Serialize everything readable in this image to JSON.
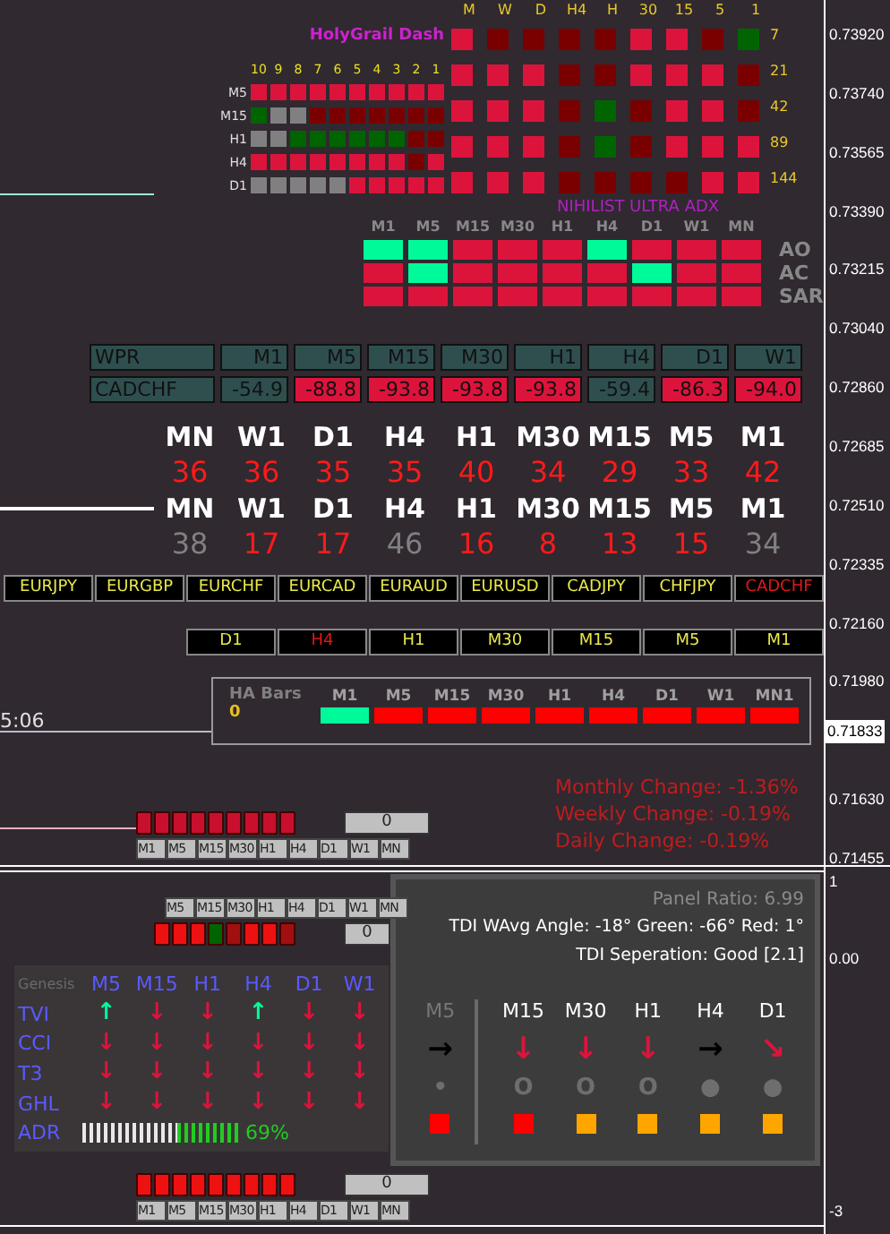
{
  "price_axis": {
    "labels": [
      "0.73920",
      "0.73740",
      "0.73565",
      "0.73390",
      "0.73215",
      "0.73040",
      "0.72860",
      "0.72685",
      "0.72510",
      "0.72335",
      "0.72160",
      "0.71980",
      "0.71630",
      "0.71455"
    ],
    "current_price": "0.71833"
  },
  "time_label": "5:06",
  "holygrail_dash": {
    "title": "HolyGrail Dash",
    "columns": [
      "M",
      "W",
      "D",
      "H4",
      "H",
      "30",
      "15",
      "5",
      "1"
    ],
    "rows": [
      {
        "period": "7",
        "cells": [
          {
            "color": "#dc143c"
          },
          {
            "color": "#7a0000"
          },
          {
            "color": "#7a0000"
          },
          {
            "color": "#7a0000"
          },
          {
            "color": "#7a0000"
          },
          {
            "color": "#dc143c"
          },
          {
            "color": "#dc143c"
          },
          {
            "color": "#7a0000"
          },
          {
            "color": "#006400"
          }
        ]
      },
      {
        "period": "21",
        "cells": [
          {
            "color": "#dc143c"
          },
          {
            "color": "#dc143c"
          },
          {
            "color": "#dc143c"
          },
          {
            "color": "#7a0000"
          },
          {
            "color": "#7a0000"
          },
          {
            "color": "#dc143c"
          },
          {
            "color": "#dc143c"
          },
          {
            "color": "#dc143c"
          },
          {
            "color": "#7a0000"
          }
        ]
      },
      {
        "period": "42",
        "cells": [
          {
            "color": "#dc143c"
          },
          {
            "color": "#dc143c"
          },
          {
            "color": "#dc143c"
          },
          {
            "color": "#7a0000"
          },
          {
            "color": "#006400"
          },
          {
            "color": "#7a0000"
          },
          {
            "color": "#dc143c"
          },
          {
            "color": "#dc143c"
          },
          {
            "color": "#7a0000"
          }
        ]
      },
      {
        "period": "89",
        "cells": [
          {
            "color": "#dc143c"
          },
          {
            "color": "#dc143c"
          },
          {
            "color": "#dc143c"
          },
          {
            "color": "#7a0000"
          },
          {
            "color": "#006400"
          },
          {
            "color": "#7a0000"
          },
          {
            "color": "#dc143c"
          },
          {
            "color": "#dc143c"
          },
          {
            "color": "#dc143c"
          }
        ]
      },
      {
        "period": "144",
        "cells": [
          {
            "color": "#dc143c"
          },
          {
            "color": "#dc143c"
          },
          {
            "color": "#dc143c"
          },
          {
            "color": "#7a0000"
          },
          {
            "color": "#7a0000"
          },
          {
            "color": "#7a0000"
          },
          {
            "color": "#7a0000"
          },
          {
            "color": "#dc143c"
          },
          {
            "color": "#dc143c"
          }
        ]
      }
    ],
    "bar_numbers": [
      "10",
      "9",
      "8",
      "7",
      "6",
      "5",
      "4",
      "3",
      "2",
      "1"
    ],
    "bar_rows": [
      {
        "label": "M5",
        "cells": [
          {
            "color": "#dc143c"
          },
          {
            "color": "#dc143c"
          },
          {
            "color": "#dc143c"
          },
          {
            "color": "#dc143c"
          },
          {
            "color": "#dc143c"
          },
          {
            "color": "#dc143c"
          },
          {
            "color": "#dc143c"
          },
          {
            "color": "#dc143c"
          },
          {
            "color": "#dc143c"
          },
          {
            "color": "#dc143c"
          }
        ]
      },
      {
        "label": "M15",
        "cells": [
          {
            "color": "#006400"
          },
          {
            "color": "#808080"
          },
          {
            "color": "#808080"
          },
          {
            "color": "#7a0000"
          },
          {
            "color": "#7a0000"
          },
          {
            "color": "#7a0000"
          },
          {
            "color": "#7a0000"
          },
          {
            "color": "#7a0000"
          },
          {
            "color": "#7a0000"
          },
          {
            "color": "#7a0000"
          }
        ]
      },
      {
        "label": "H1",
        "cells": [
          {
            "color": "#808080"
          },
          {
            "color": "#808080"
          },
          {
            "color": "#006400"
          },
          {
            "color": "#006400"
          },
          {
            "color": "#006400"
          },
          {
            "color": "#006400"
          },
          {
            "color": "#006400"
          },
          {
            "color": "#006400"
          },
          {
            "color": "#7a0000"
          },
          {
            "color": "#7a0000"
          }
        ]
      },
      {
        "label": "H4",
        "cells": [
          {
            "color": "#dc143c"
          },
          {
            "color": "#dc143c"
          },
          {
            "color": "#dc143c"
          },
          {
            "color": "#dc143c"
          },
          {
            "color": "#dc143c"
          },
          {
            "color": "#dc143c"
          },
          {
            "color": "#dc143c"
          },
          {
            "color": "#dc143c"
          },
          {
            "color": "#7a0000"
          },
          {
            "color": "#dc143c"
          }
        ]
      },
      {
        "label": "D1",
        "cells": [
          {
            "color": "#808080"
          },
          {
            "color": "#808080"
          },
          {
            "color": "#808080"
          },
          {
            "color": "#808080"
          },
          {
            "color": "#808080"
          },
          {
            "color": "#dc143c"
          },
          {
            "color": "#dc143c"
          },
          {
            "color": "#dc143c"
          },
          {
            "color": "#dc143c"
          },
          {
            "color": "#dc143c"
          }
        ]
      }
    ]
  },
  "ultra_adx": {
    "title": "NIHILIST ULTRA ADX",
    "columns": [
      "M1",
      "M5",
      "M15",
      "M30",
      "H1",
      "H4",
      "D1",
      "W1",
      "MN"
    ],
    "rows": [
      {
        "label": "AO",
        "cells": [
          {
            "color": "#00fa9a"
          },
          {
            "color": "#00fa9a"
          },
          {
            "color": "#dc143c"
          },
          {
            "color": "#dc143c"
          },
          {
            "color": "#dc143c"
          },
          {
            "color": "#00fa9a"
          },
          {
            "color": "#dc143c"
          },
          {
            "color": "#dc143c"
          },
          {
            "color": "#dc143c"
          }
        ]
      },
      {
        "label": "AC",
        "cells": [
          {
            "color": "#dc143c"
          },
          {
            "color": "#00fa9a"
          },
          {
            "color": "#dc143c"
          },
          {
            "color": "#dc143c"
          },
          {
            "color": "#dc143c"
          },
          {
            "color": "#dc143c"
          },
          {
            "color": "#00fa9a"
          },
          {
            "color": "#dc143c"
          },
          {
            "color": "#dc143c"
          }
        ]
      },
      {
        "label": "SAR",
        "cells": [
          {
            "color": "#dc143c"
          },
          {
            "color": "#dc143c"
          },
          {
            "color": "#dc143c"
          },
          {
            "color": "#dc143c"
          },
          {
            "color": "#dc143c"
          },
          {
            "color": "#dc143c"
          },
          {
            "color": "#dc143c"
          },
          {
            "color": "#dc143c"
          },
          {
            "color": "#dc143c"
          }
        ]
      }
    ]
  },
  "wpr_table": {
    "header": [
      "WPR",
      "M1",
      "M5",
      "M15",
      "M30",
      "H1",
      "H4",
      "D1",
      "W1"
    ],
    "symbol": "CADCHF",
    "values": [
      {
        "text": "-54.9",
        "color": "#2f4f4f"
      },
      {
        "text": "-88.8",
        "color": "#dc143c"
      },
      {
        "text": "-93.8",
        "color": "#dc143c"
      },
      {
        "text": "-93.8",
        "color": "#dc143c"
      },
      {
        "text": "-93.8",
        "color": "#dc143c"
      },
      {
        "text": "-59.4",
        "color": "#2f4f4f"
      },
      {
        "text": "-86.3",
        "color": "#dc143c"
      },
      {
        "text": "-94.0",
        "color": "#dc143c"
      }
    ]
  },
  "strength": [
    {
      "labels": [
        "MN",
        "W1",
        "D1",
        "H4",
        "H1",
        "M30",
        "M15",
        "M5",
        "M1"
      ],
      "values": [
        {
          "text": "36",
          "color": "#ff1a1a"
        },
        {
          "text": "36",
          "color": "#ff1a1a"
        },
        {
          "text": "35",
          "color": "#ff1a1a"
        },
        {
          "text": "35",
          "color": "#ff1a1a"
        },
        {
          "text": "40",
          "color": "#ff1a1a"
        },
        {
          "text": "34",
          "color": "#ff1a1a"
        },
        {
          "text": "29",
          "color": "#ff1a1a"
        },
        {
          "text": "33",
          "color": "#ff1a1a"
        },
        {
          "text": "42",
          "color": "#ff1a1a"
        }
      ]
    },
    {
      "labels": [
        "MN",
        "W1",
        "D1",
        "H4",
        "H1",
        "M30",
        "M15",
        "M5",
        "M1"
      ],
      "values": [
        {
          "text": "38",
          "color": "#808080"
        },
        {
          "text": "17",
          "color": "#ff1a1a"
        },
        {
          "text": "17",
          "color": "#ff1a1a"
        },
        {
          "text": "46",
          "color": "#808080"
        },
        {
          "text": "16",
          "color": "#ff1a1a"
        },
        {
          "text": "8",
          "color": "#ff1a1a"
        },
        {
          "text": "13",
          "color": "#ff1a1a"
        },
        {
          "text": "15",
          "color": "#ff1a1a"
        },
        {
          "text": "34",
          "color": "#808080"
        }
      ]
    }
  ],
  "pairs": [
    {
      "label": "EURJPY",
      "selected": false
    },
    {
      "label": "EURGBP",
      "selected": false
    },
    {
      "label": "EURCHF",
      "selected": false
    },
    {
      "label": "EURCAD",
      "selected": false
    },
    {
      "label": "EURAUD",
      "selected": false
    },
    {
      "label": "EURUSD",
      "selected": false
    },
    {
      "label": "CADJPY",
      "selected": false
    },
    {
      "label": "CHFJPY",
      "selected": false
    },
    {
      "label": "CADCHF",
      "selected": true
    }
  ],
  "timeframes": [
    {
      "label": "D1",
      "selected": false
    },
    {
      "label": "H4",
      "selected": true
    },
    {
      "label": "H1",
      "selected": false
    },
    {
      "label": "M30",
      "selected": false
    },
    {
      "label": "M15",
      "selected": false
    },
    {
      "label": "M5",
      "selected": false
    },
    {
      "label": "M1",
      "selected": false
    }
  ],
  "ha_bars": {
    "title": "HA Bars",
    "count": "0",
    "columns": [
      {
        "label": "M1",
        "color": "#00fa9a"
      },
      {
        "label": "M5",
        "color": "#ff0000"
      },
      {
        "label": "M15",
        "color": "#ff0000"
      },
      {
        "label": "M30",
        "color": "#ff0000"
      },
      {
        "label": "H1",
        "color": "#ff0000"
      },
      {
        "label": "H4",
        "color": "#ff0000"
      },
      {
        "label": "D1",
        "color": "#ff0000"
      },
      {
        "label": "W1",
        "color": "#ff0000"
      },
      {
        "label": "MN1",
        "color": "#ff0000"
      }
    ]
  },
  "changes": [
    "Monthly Change: -1.36%",
    "Weekly Change: -0.19%",
    "Daily Change: -0.19%"
  ],
  "mini_widgets": [
    {
      "kind": "labels_below",
      "cells": [
        {
          "color": "#c8102e"
        },
        {
          "color": "#c8102e"
        },
        {
          "color": "#c8102e"
        },
        {
          "color": "#c8102e"
        },
        {
          "color": "#c8102e"
        },
        {
          "color": "#c8102e"
        },
        {
          "color": "#c8102e"
        },
        {
          "color": "#c8102e"
        },
        {
          "color": "#c8102e"
        }
      ],
      "count": "0",
      "labels": [
        "M1",
        "M5",
        "M15",
        "M30",
        "H1",
        "H4",
        "D1",
        "W1",
        "MN"
      ]
    },
    {
      "kind": "labels_above",
      "cells": [
        {
          "color": "#ee1111"
        },
        {
          "color": "#ee1111"
        },
        {
          "color": "#ee1111"
        },
        {
          "color": "#006400"
        },
        {
          "color": "#a01010"
        },
        {
          "color": "#ee1111"
        },
        {
          "color": "#ee1111"
        },
        {
          "color": "#a01010"
        }
      ],
      "count": "0",
      "labels": [
        "M5",
        "M15",
        "M30",
        "H1",
        "H4",
        "D1",
        "W1",
        "MN"
      ]
    },
    {
      "kind": "labels_below",
      "cells": [
        {
          "color": "#ee1111"
        },
        {
          "color": "#ee1111"
        },
        {
          "color": "#ee1111"
        },
        {
          "color": "#ee1111"
        },
        {
          "color": "#ee1111"
        },
        {
          "color": "#ee1111"
        },
        {
          "color": "#ee1111"
        },
        {
          "color": "#ee1111"
        },
        {
          "color": "#ee1111"
        }
      ],
      "count": "0",
      "labels": [
        "M1",
        "M5",
        "M15",
        "M30",
        "H1",
        "H4",
        "D1",
        "W1",
        "MN"
      ]
    }
  ],
  "genesis": {
    "title": "Genesis",
    "columns": [
      "M5",
      "M15",
      "H1",
      "H4",
      "D1",
      "W1"
    ],
    "rows": [
      {
        "kind": "arrows",
        "label": "TVI",
        "arrows": [
          {
            "glyph": "↑",
            "color": "#00fa9a"
          },
          {
            "glyph": "↓",
            "color": "#dc143c"
          },
          {
            "glyph": "↓",
            "color": "#dc143c"
          },
          {
            "glyph": "↑",
            "color": "#00fa9a"
          },
          {
            "glyph": "↓",
            "color": "#dc143c"
          },
          {
            "glyph": "↓",
            "color": "#dc143c"
          }
        ]
      },
      {
        "kind": "arrows",
        "label": "CCI",
        "arrows": [
          {
            "glyph": "↓",
            "color": "#dc143c"
          },
          {
            "glyph": "↓",
            "color": "#dc143c"
          },
          {
            "glyph": "↓",
            "color": "#dc143c"
          },
          {
            "glyph": "↓",
            "color": "#dc143c"
          },
          {
            "glyph": "↓",
            "color": "#dc143c"
          },
          {
            "glyph": "↓",
            "color": "#dc143c"
          }
        ]
      },
      {
        "kind": "arrows",
        "label": "T3",
        "arrows": [
          {
            "glyph": "↓",
            "color": "#dc143c"
          },
          {
            "glyph": "↓",
            "color": "#dc143c"
          },
          {
            "glyph": "↓",
            "color": "#dc143c"
          },
          {
            "glyph": "↓",
            "color": "#dc143c"
          },
          {
            "glyph": "↓",
            "color": "#dc143c"
          },
          {
            "glyph": "↓",
            "color": "#dc143c"
          }
        ]
      },
      {
        "kind": "arrows",
        "label": "GHL",
        "arrows": [
          {
            "glyph": "↓",
            "color": "#dc143c"
          },
          {
            "glyph": "↓",
            "color": "#dc143c"
          },
          {
            "glyph": "↓",
            "color": "#dc143c"
          },
          {
            "glyph": "↓",
            "color": "#dc143c"
          },
          {
            "glyph": "↓",
            "color": "#dc143c"
          },
          {
            "glyph": "↓",
            "color": "#dc143c"
          }
        ]
      },
      {
        "kind": "meter",
        "label": "ADR",
        "level": 0.4,
        "reading": "69%"
      }
    ]
  },
  "tdi_panel": {
    "panel_ratio": "Panel Ratio: 6.99",
    "angle": "TDI WAvg Angle: -18°  Green: -66°  Red: 1°",
    "separation": "TDI Seperation: Good [2.1]",
    "columns": [
      {
        "label": "M5",
        "dimmed": true,
        "arrow": {
          "glyph": "→",
          "color": "#000000"
        },
        "dot": "•",
        "square": {
          "color": "#ff0000"
        }
      },
      {
        "label": "M15",
        "dimmed": false,
        "arrow": {
          "glyph": "↓",
          "color": "#dc143c"
        },
        "dot": "O",
        "square": {
          "color": "#ff0000"
        }
      },
      {
        "label": "M30",
        "dimmed": false,
        "arrow": {
          "glyph": "↓",
          "color": "#dc143c"
        },
        "dot": "O",
        "square": {
          "color": "#ffa500"
        }
      },
      {
        "label": "H1",
        "dimmed": false,
        "arrow": {
          "glyph": "↓",
          "color": "#dc143c"
        },
        "dot": "O",
        "square": {
          "color": "#ffa500"
        }
      },
      {
        "label": "H4",
        "dimmed": false,
        "arrow": {
          "glyph": "→",
          "color": "#000000"
        },
        "dot": "●",
        "square": {
          "color": "#ffa500"
        }
      },
      {
        "label": "D1",
        "dimmed": false,
        "arrow": {
          "glyph": "↘",
          "color": "#dc143c"
        },
        "dot": "●",
        "square": {
          "color": "#ffa500"
        }
      }
    ]
  },
  "subwindow_axis": [
    "1",
    "0.00",
    "-3"
  ]
}
